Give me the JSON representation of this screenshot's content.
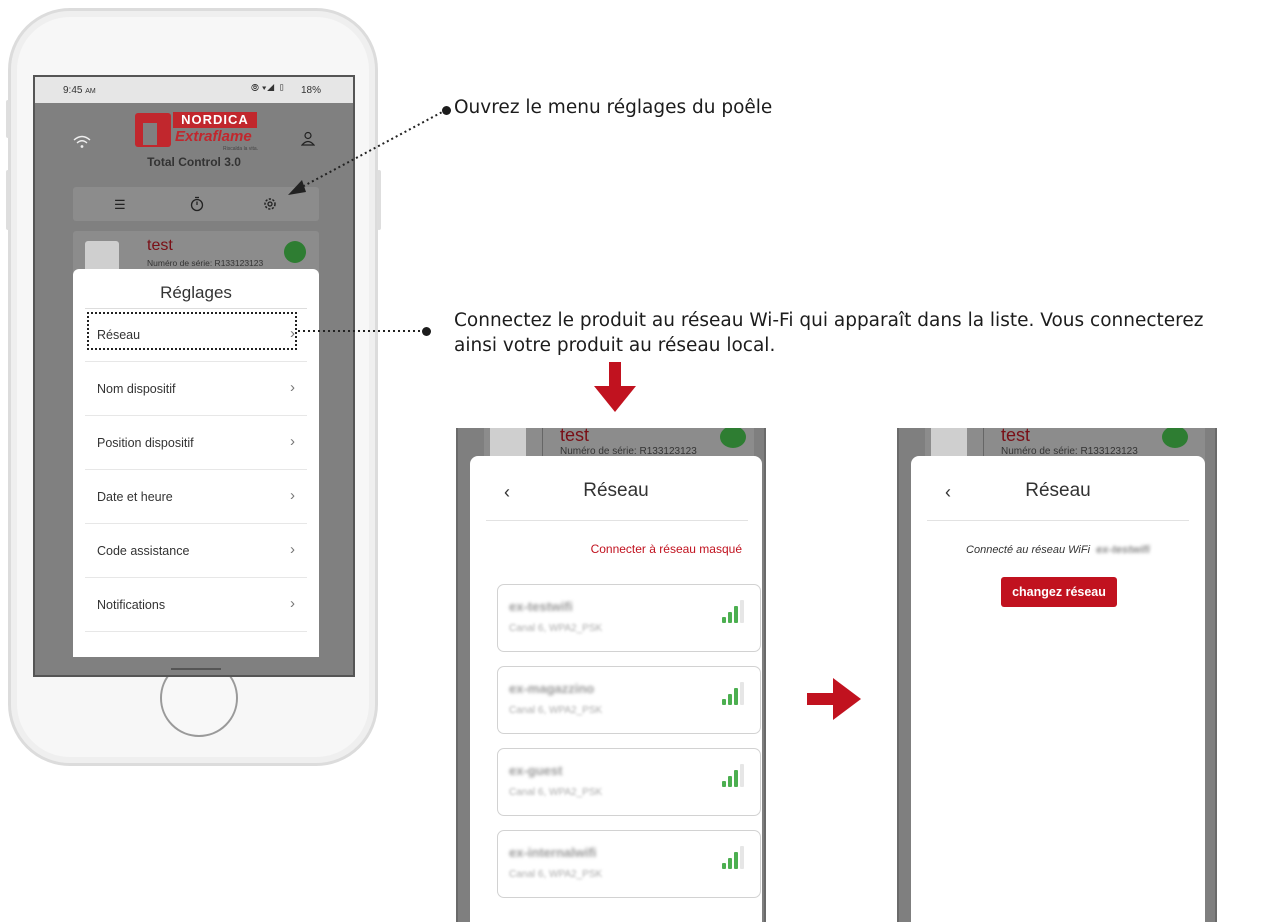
{
  "phone": {
    "status_time": "9:45",
    "status_ampm": "AM",
    "status_battery": "18%",
    "brand_top": "NORDICA",
    "brand_bottom": "Extraflame",
    "brand_tagline": "Riscalda la vita.",
    "app_title": "Total Control 3.0",
    "device_name": "test",
    "device_serial": "Numéro de série: R133123123",
    "settings_title": "Réglages",
    "menu_items": [
      "Réseau",
      "Nom dispositif",
      "Position dispositif",
      "Date et heure",
      "Code assistance",
      "Notifications"
    ]
  },
  "callouts": {
    "step1": "Ouvrez le menu réglages du poêle",
    "step2_line1": "Connectez le produit au réseau Wi-Fi qui apparaît dans la liste. Vous connecterez",
    "step2_line2": "ainsi votre produit au réseau local."
  },
  "network_screen": {
    "device_name": "test",
    "device_serial": "Numéro de série: R133123123",
    "back": "‹",
    "title": "Réseau",
    "hidden_network_link": "Connecter à réseau masqué",
    "networks": [
      {
        "name": "ex-testwifi",
        "detail": "Canal 6, WPA2_PSK"
      },
      {
        "name": "ex-magazzino",
        "detail": "Canal 6, WPA2_PSK"
      },
      {
        "name": "ex-guest",
        "detail": "Canal 6, WPA2_PSK"
      },
      {
        "name": "ex-internalwifi",
        "detail": "Canal 6, WPA2_PSK"
      }
    ]
  },
  "connected_screen": {
    "device_name": "test",
    "device_serial": "Numéro de série: R133123123",
    "back": "‹",
    "title": "Réseau",
    "connected_label": "Connecté au réseau WiFi",
    "connected_network": "ex-testwifi",
    "change_button": "changez réseau"
  },
  "colors": {
    "accent_red": "#c1121f",
    "wifi_green": "#4caf50"
  }
}
